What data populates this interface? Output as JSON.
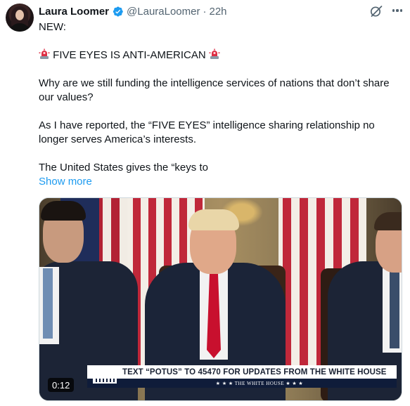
{
  "author": {
    "name": "Laura Loomer",
    "handle": "@LauraLoomer",
    "separator": "·",
    "time": "22h"
  },
  "tweet": {
    "line1": "NEW:",
    "headline": "FIVE EYES IS ANTI-AMERICAN",
    "para1_line1": "Why are we still funding the intelligence services of nations that don’t share",
    "para1_line2": "our values?",
    "para2_line1": "As I have reported, the “FIVE EYES” intelligence sharing relationship no",
    "para2_line2": "longer serves America’s interests.",
    "para3_line1": "The United States gives the “keys to",
    "show_more": "Show more"
  },
  "media": {
    "type": "video",
    "banner_text": "TEXT “POTUS” TO 45470 FOR UPDATES FROM THE WHITE HOUSE",
    "banner_subtext": "★ ★ ★   THE WHITE HOUSE   ★ ★ ★",
    "duration": "0:12"
  },
  "icons": {
    "verified": "verified-badge-icon",
    "grok": "grok-icon",
    "more": "more-options-icon",
    "alarm": "police-light-emoji"
  },
  "colors": {
    "accent": "#1d9bf0",
    "secondary_text": "#536471",
    "primary_text": "#0f1419"
  }
}
